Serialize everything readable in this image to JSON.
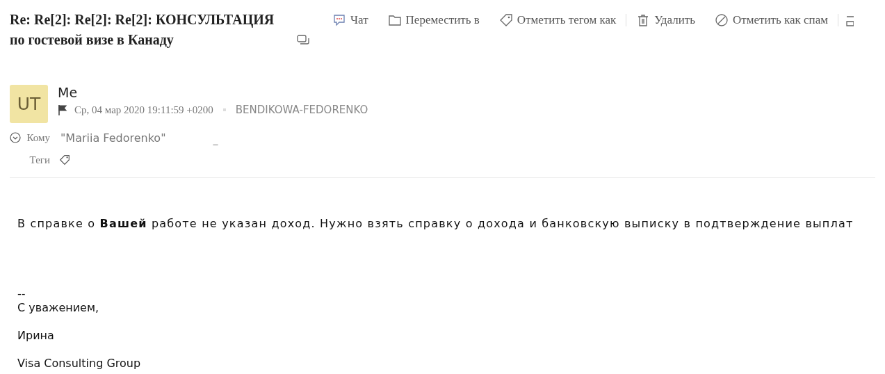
{
  "subject": "Re: Re[2]: Re[2]: Re[2]: КОНСУЛЬТАЦИЯ по гостевой визе в Канаду",
  "toolbar": [
    {
      "kind": "chat",
      "label": "Чат"
    },
    {
      "kind": "folder",
      "label": "Переместить в"
    },
    {
      "kind": "tag",
      "label": "Отметить тегом как"
    },
    {
      "kind": "separator"
    },
    {
      "kind": "trash",
      "label": "Удалить"
    },
    {
      "kind": "spam",
      "label": "Отметить как спам"
    },
    {
      "kind": "separator"
    },
    {
      "kind": "more"
    }
  ],
  "message": {
    "avatar": "UT",
    "sender": "Me",
    "flagged": true,
    "date": "Ср, 04 мар 2020 19:11:59 +0200",
    "account": "BENDIKOWA-FEDORENKO",
    "to_label": "Кому",
    "to": "\"Mariia Fedorenko\"",
    "to_extra": "_",
    "tags_label": "Теги"
  },
  "body": [
    "В справке о **Вашей** работе не указан доход. Нужно взять справку о дохода и банковскую выписку в подтверждение выплат"
  ],
  "signature": [
    "--",
    "С уважением,",
    "Ирина",
    "Visa Consulting Group"
  ]
}
